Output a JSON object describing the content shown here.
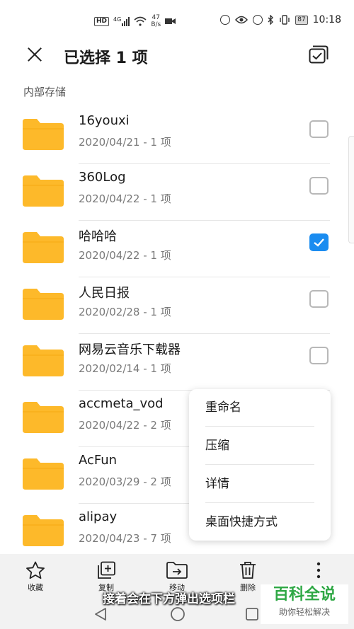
{
  "status_bar": {
    "hd": "HD",
    "network": "4G",
    "speed_value": "47",
    "speed_unit": "B/s",
    "battery": "87",
    "time": "10:18"
  },
  "header": {
    "title": "已选择 1 项"
  },
  "section_label": "内部存储",
  "folders": [
    {
      "name": "16youxi",
      "meta": "2020/04/21 - 1 项",
      "checked": false
    },
    {
      "name": "360Log",
      "meta": "2020/04/22 - 1 项",
      "checked": false
    },
    {
      "name": "哈哈哈",
      "meta": "2020/04/22 - 1 项",
      "checked": true
    },
    {
      "name": "人民日报",
      "meta": "2020/02/28 - 1 项",
      "checked": false
    },
    {
      "name": "网易云音乐下载器",
      "meta": "2020/02/14 - 1 项",
      "checked": false
    },
    {
      "name": "accmeta_vod",
      "meta": "2020/04/22 - 2 项",
      "checked": false
    },
    {
      "name": "AcFun",
      "meta": "2020/03/29 - 2 项",
      "checked": false
    },
    {
      "name": "alipay",
      "meta": "2020/04/23 - 7 项",
      "checked": false
    }
  ],
  "popup_menu": [
    "重命名",
    "压缩",
    "详情",
    "桌面快捷方式"
  ],
  "toolbar": {
    "favorite": "收藏",
    "copy": "复制",
    "move": "移动",
    "delete": "删除"
  },
  "caption": "接着会在下方弹出选项栏",
  "watermark": {
    "title": "百科全说",
    "subtitle": "助你轻松解决"
  },
  "colors": {
    "folder": "#FDB92A",
    "checked": "#1A8CF0",
    "watermark": "#2FA845"
  }
}
